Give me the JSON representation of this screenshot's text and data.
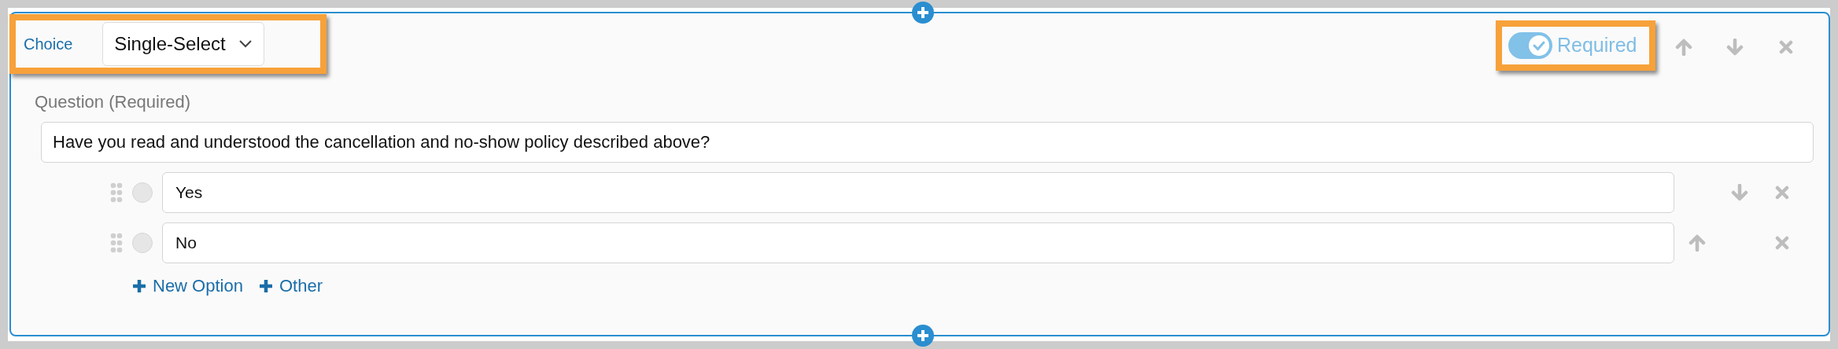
{
  "header": {
    "type_label": "Choice",
    "select": {
      "value": "Single-Select"
    },
    "required_toggle": {
      "label": "Required",
      "on": true
    }
  },
  "question": {
    "label": "Question (Required)",
    "value": "Have you read and understood the cancellation and no-show policy described above?"
  },
  "options": [
    {
      "value": "Yes",
      "checked": false,
      "can_move_up": false,
      "can_move_down": true
    },
    {
      "value": "No",
      "checked": false,
      "can_move_up": true,
      "can_move_down": false
    }
  ],
  "add_links": [
    {
      "label": "New Option"
    },
    {
      "label": "Other"
    }
  ]
}
